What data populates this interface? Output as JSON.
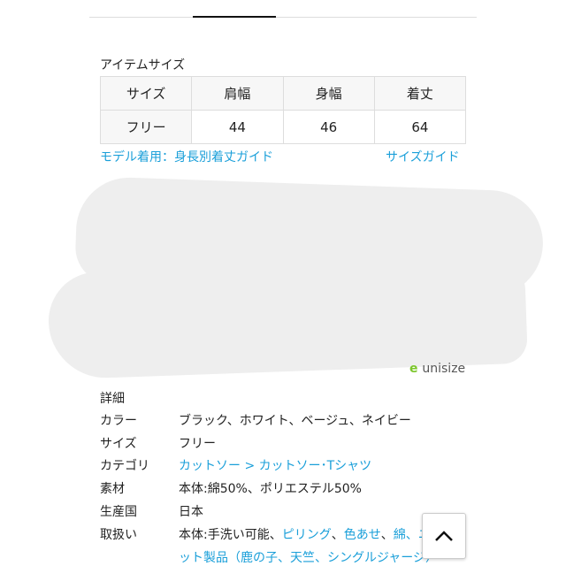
{
  "item_size": {
    "title": "アイテムサイズ",
    "headers": [
      "サイズ",
      "肩幅",
      "身幅",
      "着丈"
    ],
    "rows": [
      [
        "フリー",
        "44",
        "46",
        "64"
      ]
    ]
  },
  "links": {
    "model": "モデル着用：身長別着丈ガイド",
    "size_guide": "サイズガイド"
  },
  "unisize_logo": "unisize",
  "details": {
    "title": "詳細",
    "rows": [
      {
        "key": "カラー",
        "value": "ブラック、ホワイト、ベージュ、ネイビー"
      },
      {
        "key": "サイズ",
        "value": "フリー"
      },
      {
        "key": "カテゴリ",
        "value": "カットソー > カットソー･Tシャツ"
      },
      {
        "key": "素材",
        "value": "本体:綿50%、ポリエステル50%"
      },
      {
        "key": "生産国",
        "value": "日本"
      },
      {
        "key": "取扱い",
        "value_prefix": "本体:手洗い可能、",
        "links": [
          "ピリング",
          "色あせ",
          "綿、ニ"
        ],
        "line2": "ット製品（鹿の子、天竺、シングルジャージ）"
      }
    ]
  },
  "colors": {
    "link": "#1a9fd9",
    "unisize_green": "#7cc62c"
  },
  "icons": {
    "scroll_top": "chevron-up-icon"
  }
}
